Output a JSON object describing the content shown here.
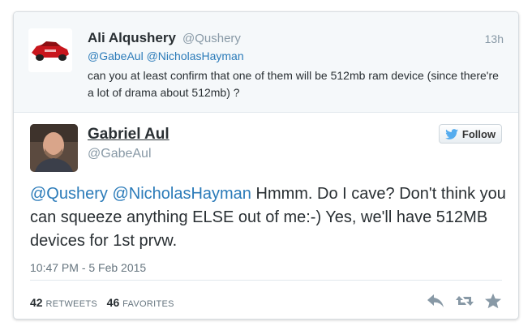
{
  "parent_tweet": {
    "name": "Ali Alqushery",
    "handle": "@Qushery",
    "time": "13h",
    "mentions": [
      "@GabeAul",
      "@NicholasHayman"
    ],
    "text": "can you at least confirm that one of them will be 512mb ram device (since there're a lot of drama about 512mb) ?"
  },
  "main_tweet": {
    "name": "Gabriel Aul",
    "handle": "@GabeAul",
    "follow_label": "Follow",
    "mentions": [
      "@Qushery",
      "@NicholasHayman"
    ],
    "text": "Hmmm. Do I cave? Don't think you can squeeze anything ELSE out of me:-) Yes, we'll have 512MB devices for 1st prvw.",
    "timestamp": "10:47 PM - 5 Feb 2015"
  },
  "stats": {
    "retweets_count": "42",
    "retweets_label": "RETWEETS",
    "favorites_count": "46",
    "favorites_label": "FAVORITES"
  },
  "icons": {
    "follow": "twitter-bird-icon",
    "reply": "reply-icon",
    "retweet": "retweet-icon",
    "favorite": "star-icon"
  },
  "colors": {
    "link": "#2b7bb9",
    "twitter_blue": "#55acee",
    "muted": "#8899a6",
    "action_icon": "#8899a6"
  }
}
